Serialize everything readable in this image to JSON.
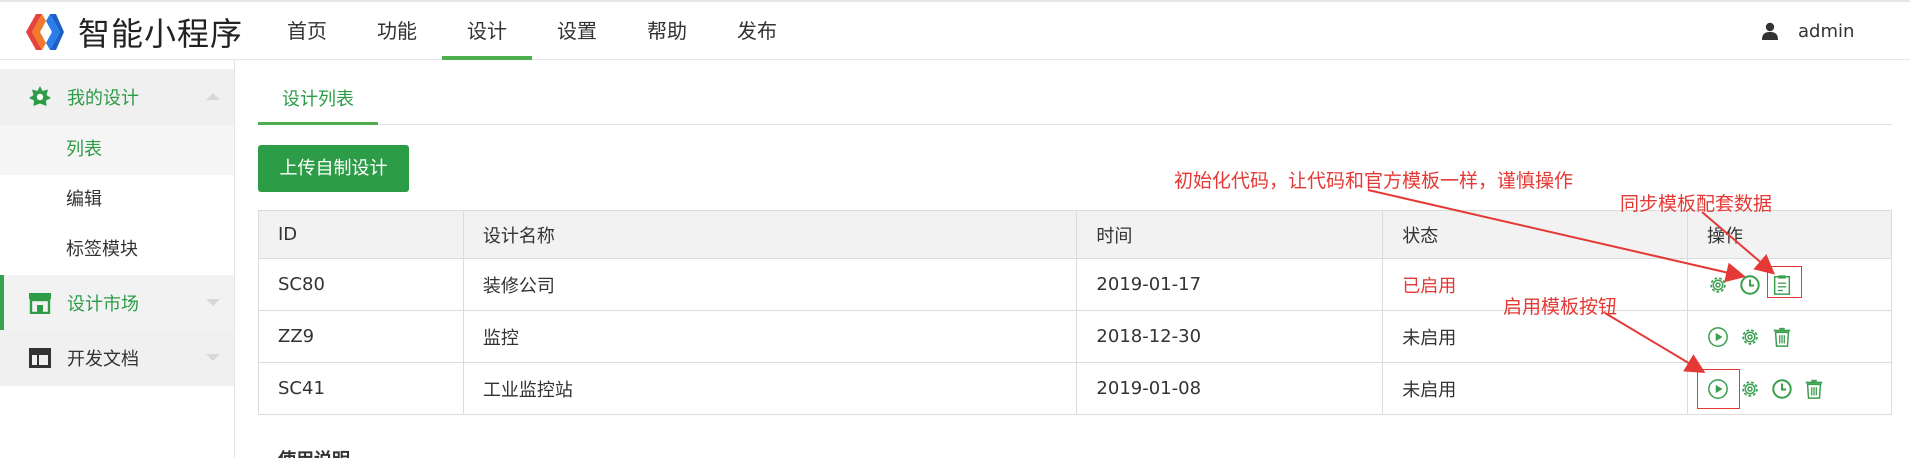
{
  "brand": {
    "name": "智能小程序"
  },
  "nav": {
    "items": [
      {
        "label": "首页"
      },
      {
        "label": "功能"
      },
      {
        "label": "设计"
      },
      {
        "label": "设置"
      },
      {
        "label": "帮助"
      },
      {
        "label": "发布"
      }
    ],
    "active_index": 2
  },
  "user": {
    "name": "admin"
  },
  "sidebar": {
    "groups": [
      {
        "label": "我的设计",
        "icon": "star-badge-icon",
        "expanded": true,
        "items": [
          {
            "label": "列表",
            "active": true
          },
          {
            "label": "编辑"
          },
          {
            "label": "标签模块"
          }
        ]
      },
      {
        "label": "设计市场",
        "icon": "store-icon",
        "expanded": false
      },
      {
        "label": "开发文档",
        "icon": "layout-icon",
        "expanded": false
      }
    ]
  },
  "tabs": [
    {
      "label": "设计列表"
    }
  ],
  "upload_button": {
    "label": "上传自制设计"
  },
  "table": {
    "headers": [
      "ID",
      "设计名称",
      "时间",
      "状态",
      "操作"
    ],
    "rows": [
      {
        "id": "SC80",
        "name": "装修公司",
        "date": "2019-01-17",
        "status": "已启用",
        "status_active": true,
        "ops": [
          "gear-icon",
          "clock-icon",
          "clipboard-icon"
        ]
      },
      {
        "id": "ZZ9",
        "name": "监控",
        "date": "2018-12-30",
        "status": "未启用",
        "status_active": false,
        "ops": [
          "play-icon",
          "gear-icon",
          "trash-icon"
        ]
      },
      {
        "id": "SC41",
        "name": "工业监控站",
        "date": "2019-01-08",
        "status": "未启用",
        "status_active": false,
        "ops": [
          "play-icon",
          "gear-icon",
          "clock-icon",
          "trash-icon"
        ]
      }
    ]
  },
  "section_title": "使用说明",
  "annotations": {
    "init_code": "初始化代码，让代码和官方模板一样，谨慎操作",
    "sync_data": "同步模板配套数据",
    "enable_button": "启用模板按钮"
  },
  "colors": {
    "accent": "#2d9c47",
    "danger": "#e53935",
    "icon_green": "#3a9e4f"
  }
}
